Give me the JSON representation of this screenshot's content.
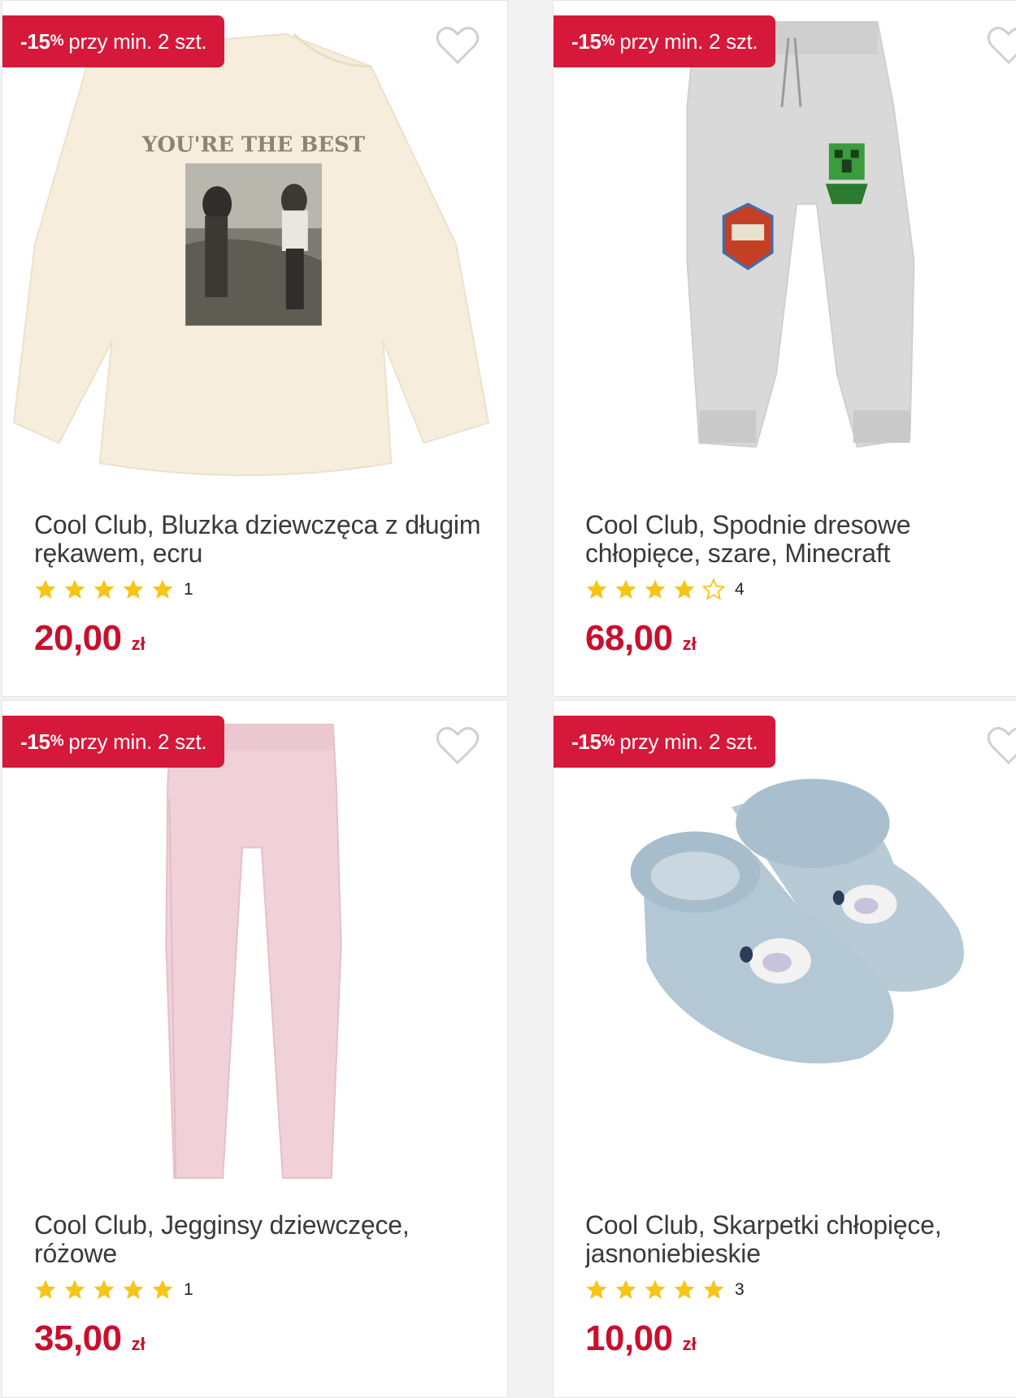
{
  "colors": {
    "accent": "#d6183a",
    "price": "#c8102e",
    "star": "#f5c518"
  },
  "products": [
    {
      "badge_pct": "-15",
      "badge_pct_sign": "%",
      "badge_text": "przy min. 2 szt.",
      "title": "Cool Club, Bluzka dziewczęca z długim rękawem, ecru",
      "rating_stars": 5,
      "rating_count": "1",
      "price": "20,00",
      "currency": "zł",
      "image": "cream-long-sleeve-shirt",
      "image_print_text": "YOU'RE THE BEST"
    },
    {
      "badge_pct": "-15",
      "badge_pct_sign": "%",
      "badge_text": "przy min. 2 szt.",
      "title": "Cool Club, Spodnie dresowe chłopięce, szare, Minecraft",
      "rating_stars": 4,
      "rating_count": "4",
      "price": "68,00",
      "currency": "zł",
      "image": "grey-jogger-pants-minecraft"
    },
    {
      "badge_pct": "-15",
      "badge_pct_sign": "%",
      "badge_text": "przy min. 2 szt.",
      "title": "Cool Club, Jegginsy dziewczęce, różowe",
      "rating_stars": 5,
      "rating_count": "1",
      "price": "35,00",
      "currency": "zł",
      "image": "pink-jeggings"
    },
    {
      "badge_pct": "-15",
      "badge_pct_sign": "%",
      "badge_text": "przy min. 2 szt.",
      "title": "Cool Club, Skarpetki chłopięce, jasnoniebieskie",
      "rating_stars": 5,
      "rating_count": "3",
      "price": "10,00",
      "currency": "zł",
      "image": "light-blue-baby-socks"
    }
  ]
}
